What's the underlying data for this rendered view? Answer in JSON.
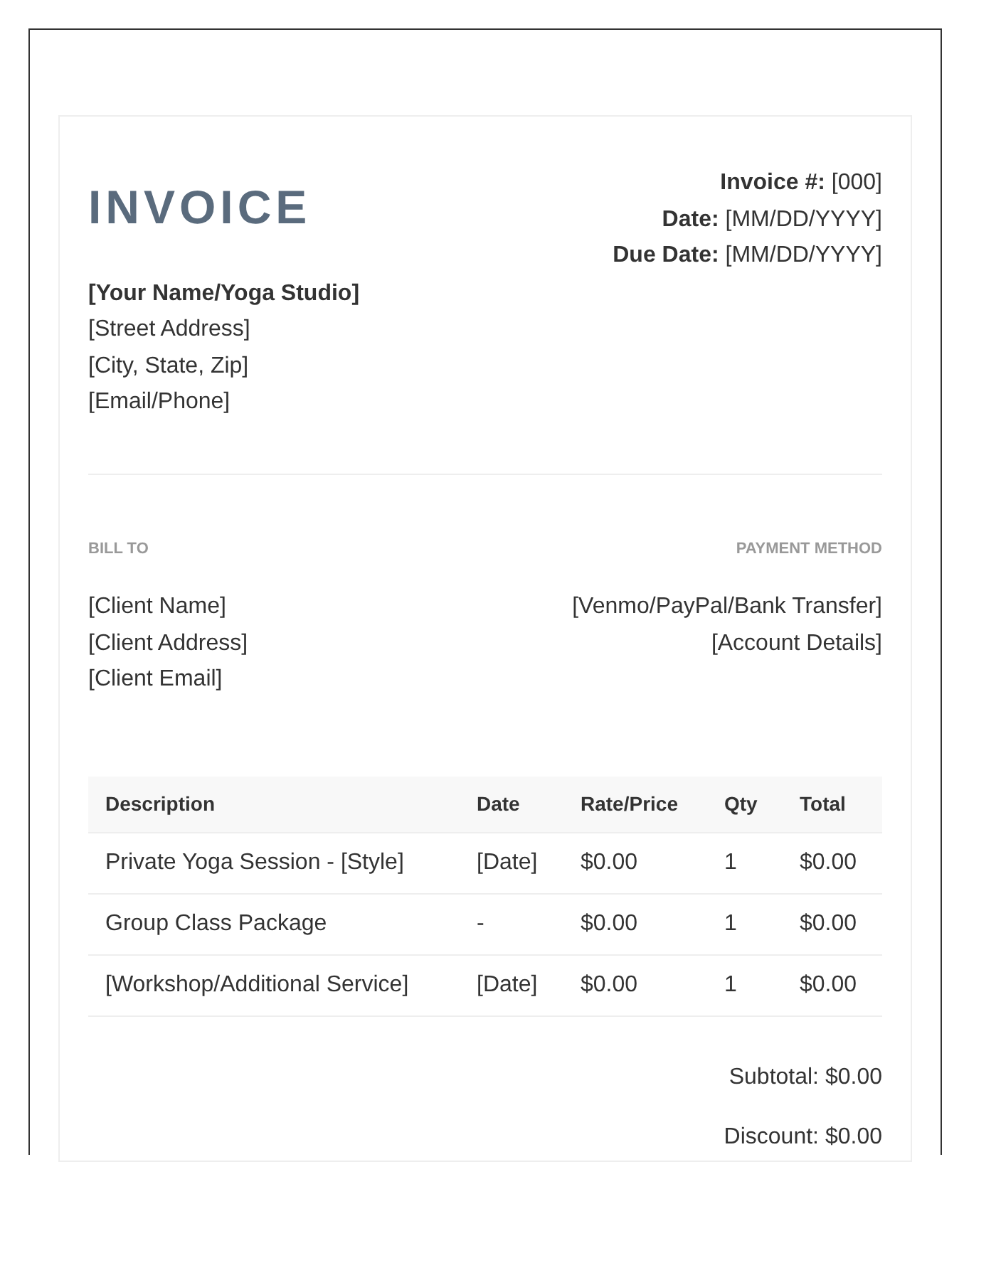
{
  "invoice": {
    "title": "INVOICE",
    "meta": [
      {
        "label": "Invoice #:",
        "value": "[000]"
      },
      {
        "label": "Date:",
        "value": "[MM/DD/YYYY]"
      },
      {
        "label": "Due Date:",
        "value": "[MM/DD/YYYY]"
      }
    ],
    "sender": {
      "name": "[Your Name/Yoga Studio]",
      "lines": [
        "[Street Address]",
        "[City, State, Zip]",
        "[Email/Phone]"
      ]
    },
    "bill_to": {
      "heading": "BILL TO",
      "lines": [
        "[Client Name]",
        "[Client Address]",
        "[Client Email]"
      ]
    },
    "payment_method": {
      "heading": "PAYMENT METHOD",
      "lines": [
        "[Venmo/PayPal/Bank Transfer]",
        "[Account Details]"
      ]
    },
    "table": {
      "columns": [
        "Description",
        "Date",
        "Rate/Price",
        "Qty",
        "Total"
      ],
      "rows": [
        [
          "Private Yoga Session - [Style]",
          "[Date]",
          "$0.00",
          "1",
          "$0.00"
        ],
        [
          "Group Class Package",
          "-",
          "$0.00",
          "1",
          "$0.00"
        ],
        [
          "[Workshop/Additional Service]",
          "[Date]",
          "$0.00",
          "1",
          "$0.00"
        ]
      ]
    },
    "totals": [
      {
        "label": "Subtotal:",
        "value": "$0.00"
      },
      {
        "label": "Discount:",
        "value": "$0.00"
      }
    ]
  }
}
